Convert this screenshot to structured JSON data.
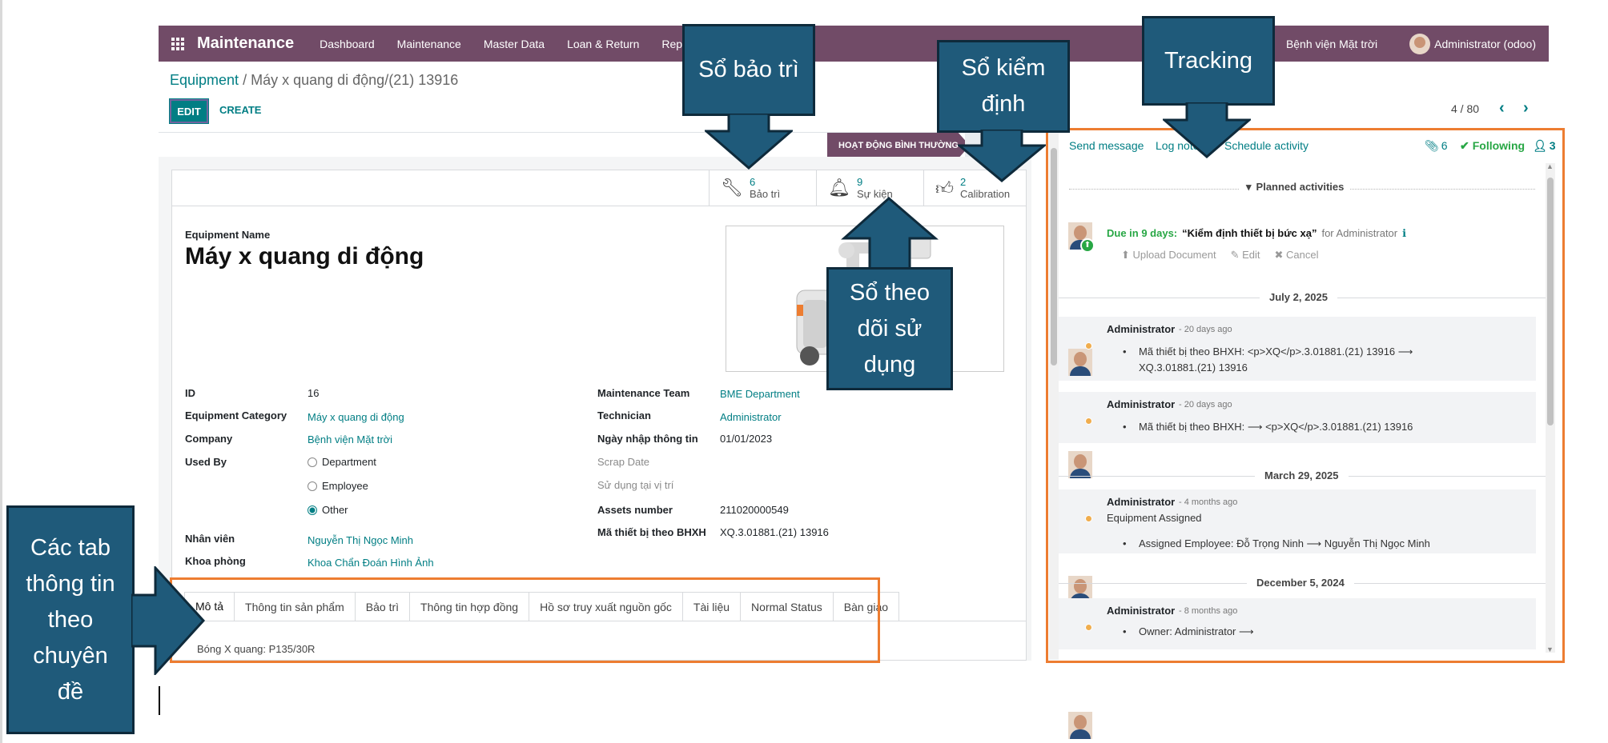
{
  "navbar": {
    "brand": "Maintenance",
    "menu": [
      "Dashboard",
      "Maintenance",
      "Master Data",
      "Loan & Return",
      "Repo"
    ],
    "company": "Bệnh viện Mặt trời",
    "user": "Administrator (odoo)"
  },
  "control": {
    "breadcrumb_root": "Equipment",
    "breadcrumb_current": "/ Máy x quang di động/(21) 13916",
    "edit_label": "EDIT",
    "create_label": "CREATE",
    "fragment": "on",
    "pager": "4 / 80",
    "status": "HOẠT ĐỘNG BÌNH THƯỜNG"
  },
  "smart_buttons": [
    {
      "count": "6",
      "label": "Bảo trì",
      "icon": "wrench-icon"
    },
    {
      "count": "9",
      "label": "Sự kiện",
      "icon": "bell-icon"
    },
    {
      "count": "2",
      "label": "Calibration",
      "icon": "thumbs-up-icon"
    }
  ],
  "form": {
    "name_label": "Equipment Name",
    "name": "Máy x quang di động",
    "left": [
      {
        "label": "ID",
        "value": "16"
      },
      {
        "label": "Equipment Category",
        "value": "Máy x quang di động"
      },
      {
        "label": "Company",
        "value": "Bệnh viện Mặt trời"
      },
      {
        "label": "Used By",
        "value": ""
      }
    ],
    "used_by_options": [
      "Department",
      "Employee",
      "Other"
    ],
    "used_by_selected": "Other",
    "nhan_vien_label": "Nhân viên",
    "nhan_vien": "Nguyễn Thị Ngọc Minh",
    "khoa_phong_label": "Khoa phòng",
    "khoa_phong": "Khoa Chẩn Đoán Hình Ảnh",
    "right": [
      {
        "label": "Maintenance Team",
        "value": "BME Department"
      },
      {
        "label": "Technician",
        "value": "Administrator"
      },
      {
        "label": "Ngày nhập thông tin",
        "value": "01/01/2023"
      },
      {
        "label": "Scrap Date",
        "value": ""
      },
      {
        "label": "Sử dụng tại vị trí",
        "value": ""
      },
      {
        "label": "Assets number",
        "value": "211020000549"
      },
      {
        "label": "Mã thiết bị theo BHXH",
        "value": "XQ.3.01881.(21) 13916"
      }
    ]
  },
  "tabs": [
    "Mô tả",
    "Thông tin sản phẩm",
    "Bảo trì",
    "Thông tin hợp đồng",
    "Hồ sơ truy xuất nguồn gốc",
    "Tài liệu",
    "Normal Status",
    "Bàn giao"
  ],
  "tab_content": "Bóng X quang: P135/30R",
  "chatter": {
    "send_message": "Send message",
    "log_note": "Log note",
    "schedule": "Schedule activity",
    "attachments": "6",
    "following": "Following",
    "followers": "3",
    "planned": "Planned activities",
    "activity_due": "Due in 9 days:",
    "activity_title": "“Kiểm định thiết bị bức xạ”",
    "activity_for": "for Administrator",
    "activity_actions": [
      "Upload Document",
      "Edit",
      "Cancel"
    ],
    "dates": [
      "July 2, 2025",
      "March 29, 2025",
      "December 5, 2024"
    ],
    "messages": [
      {
        "author": "Administrator",
        "time": "- 20 days ago",
        "lines": [
          "Mã thiết bị theo BHXH: <p>XQ</p>.3.01881.(21) 13916 ⟶",
          "XQ.3.01881.(21) 13916"
        ]
      },
      {
        "author": "Administrator",
        "time": "- 20 days ago",
        "lines": [
          "Mã thiết bị theo BHXH: ⟶ <p>XQ</p>.3.01881.(21) 13916"
        ]
      },
      {
        "author": "Administrator",
        "time": "- 4 months ago",
        "title": "Equipment Assigned",
        "lines": [
          "Assigned Employee: Đỗ Trọng Ninh ⟶ Nguyễn Thị Ngọc Minh"
        ]
      },
      {
        "author": "Administrator",
        "time": "- 8 months ago",
        "lines": [
          "Owner: Administrator ⟶"
        ]
      }
    ]
  },
  "callouts": {
    "bao_tri": "Sổ bảo trì",
    "kiem_dinh": "Sổ kiểm định",
    "tracking": "Tracking",
    "theo_doi": "Sổ theo dõi sử dụng",
    "tabs": "Các tab thông tin theo chuyên đề"
  },
  "colors": {
    "brand": "#714b67",
    "accent": "#017e84",
    "callout": "#1f5a7a",
    "highlight": "#ed7d31"
  }
}
